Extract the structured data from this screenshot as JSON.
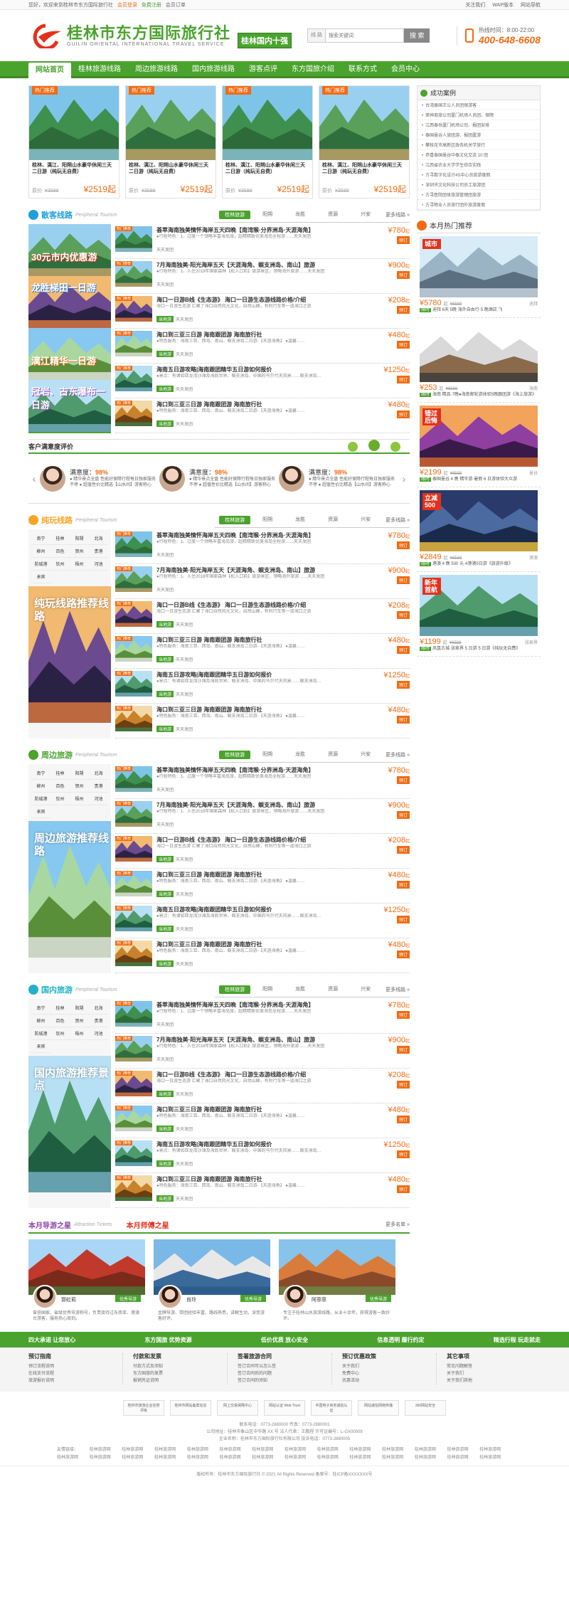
{
  "topbar": {
    "welcome": "您好，欢迎来到桂林市东方国际旅行社",
    "login": "会员登录",
    "register": "免费注册",
    "orders": "会员订单",
    "right": [
      "关注我们",
      "WAP版本",
      "网站导航"
    ]
  },
  "header": {
    "logo_name": "桂林市东方国际旅行社",
    "logo_en": "GUILIN ORIENTAL INTERNATIONAL TRAVEL SERVICE",
    "badge": "桂林国内十强",
    "search_select": "线 路",
    "search_placeholder": "搜索关键词",
    "search_button": "搜 索",
    "hotline_time": "热线时间：8:00-22:00",
    "hotline_number": "400-648-6608"
  },
  "nav": [
    "网站首页",
    "桂林旅游线路",
    "周边旅游线路",
    "国内旅游线路",
    "游客点评",
    "东方国旅介绍",
    "联系方式",
    "会员中心"
  ],
  "hot_cards": [
    {
      "tag": "热门推荐",
      "title": "桂林、漓江、阳朔山水豪华休闲三天二日游（纯玩无自费）",
      "label": "原价",
      "old": "¥3599",
      "price": "¥2519起"
    },
    {
      "tag": "热门推荐",
      "title": "桂林、漓江、阳朔山水豪华休闲三天二日游（纯玩无自费）",
      "label": "原价",
      "old": "¥3599",
      "price": "¥2519起"
    },
    {
      "tag": "热门推荐",
      "title": "桂林、漓江、阳朔山水豪华休闲三天二日游（纯玩无自费）",
      "label": "原价",
      "old": "¥3599",
      "price": "¥2519起"
    },
    {
      "tag": "热门推荐",
      "title": "桂林、漓江、阳朔山水豪华休闲三天二日游（纯玩无自费）",
      "label": "原价",
      "old": "¥3599",
      "price": "¥2519起"
    }
  ],
  "section_tabs": [
    "桂林旅游",
    "阳朔",
    "龙胜",
    "资源",
    "兴安"
  ],
  "more": "更多线路 »",
  "sections": [
    {
      "title": "散客线路",
      "en": "Peripheral Tourism",
      "color": "#1e9fd8"
    },
    {
      "title": "纯玩线路",
      "en": "Peripheral Tourism",
      "color": "#f5a623"
    },
    {
      "title": "周边旅游",
      "en": "Peripheral Tourism",
      "color": "#4aa32d"
    },
    {
      "title": "国内旅游",
      "en": "Peripheral Tourism",
      "color": "#21b0c8"
    }
  ],
  "routes": [
    {
      "name": "荟萃海南独美情怀海岸五天四晚【南湾猴·分界洲岛·天涯海角】",
      "desc": "●行程特色：1、过度一个领略丰富海岛旅，超精精致优美海岛全程游……天天发团",
      "tag": "",
      "tag2": "天天发团",
      "price": "¥780",
      "unit": "起"
    },
    {
      "name": "7月海南独美·阳光海岸五天【天涯海角、蜈支洲岛、南山】旅游",
      "desc": "●行程特色：1、入住2018年国家森林【松入口前】旅游景区，领略海外旅游……天天发团",
      "tag": "",
      "tag2": "天天发团",
      "price": "¥900",
      "unit": "起"
    },
    {
      "name": "海口一日游B线《生态游》 海口一日游生态游线路价格/介绍",
      "desc": "海口一日游生态游 汇聚了海口自然风光文化，自然山峰，有利行车等一道海口之旅",
      "tag": "当地游",
      "tag2": "天天发团",
      "price": "¥208",
      "unit": "起"
    },
    {
      "name": "海口到三亚三日游 海南跟团游 海南旅行社",
      "desc": "●特色服务：海南三亚、西岛、南山、蜈支洲岛二日游-【天涯海角】 ●温馨……",
      "tag": "当地游",
      "tag2": "天天发团",
      "price": "¥480",
      "unit": "起"
    },
    {
      "name": "海南五日游攻略|海南跟团精华五日游如何报价",
      "desc": "●景点：有诸如亚龙湾沙滩及海底世界、蜈支洲岛、中国的马尔代夫风景……蜈支洲岛…",
      "tag": "当地游",
      "tag2": "天天发团",
      "price": "¥1250",
      "unit": "起"
    },
    {
      "name": "海口到三亚三日游 海南跟团游 海南旅行社",
      "desc": "●特色服务：海南三亚、西岛、南山、蜈支洲岛二日游-【天涯海角】 ●温馨……",
      "tag": "当地游",
      "tag2": "天天发团",
      "price": "¥480",
      "unit": "起"
    }
  ],
  "book_label": "预订",
  "cities": [
    "南宁",
    "桂林",
    "阳朔",
    "北海",
    "柳州",
    "百色",
    "贺州",
    "贵港",
    "防城港",
    "钦州",
    "梧州",
    "河池",
    "来宾"
  ],
  "side_labels": {
    "s1": [
      "30元市内优惠游",
      "龙胜梯田一日游",
      "漓江精华一日游",
      "冠岩、古东瀑布一日游"
    ],
    "s2": "纯玩线路推荐线路",
    "s3": "周边旅游推荐线路",
    "s4": "国内旅游推荐景点"
  },
  "satisfaction": {
    "title": "客户满意度评价",
    "items": [
      {
        "label": "满意度：",
        "value": "98%",
        "text": "● 精华景点全盘 性能好保障行程每日独家服务不停 ● 超值性价比精选【山水间】游客称心"
      },
      {
        "label": "满意度：",
        "value": "98%",
        "text": "● 精华景点全盘 性能好保障行程每日独家服务不停 ● 超值性价比精选【山水间】游客称心"
      },
      {
        "label": "满意度：",
        "value": "98%",
        "text": "● 精华景点全盘 性能好保障行程每日独家服务不停 ● 超值性价比精选【山水间】游客称心"
      }
    ]
  },
  "success_cases": {
    "title": "成功案例",
    "items": [
      "台湾泰国王公人员团保游客",
      "荣神商旅公司厦门机场人员团、保障",
      "江西泰岳厦门机场公司、报团安排",
      "泰国曼谷人旅团游、报团厦游",
      "攀枝花市高新区政务机关学旅行",
      "恭喜泰国曼谷中泰文化交流 10 团",
      "江西省农业大学学生综合实践",
      "方寻数字化设计4S中心员旅游度假",
      "深圳市文化科技公司员工旅游团",
      "方寻医院团体旅游管理团旅游",
      "方寻物业人员旅行团外旅游度假"
    ]
  },
  "month_hot": {
    "title": "本月热门推荐",
    "items": [
      {
        "price": "¥5780",
        "unit": "起",
        "old": "¥6588",
        "dest": "迪拜",
        "badge": "限时",
        "desc": "迪拜 6天 5晚 海外自由行·5 晚酒店 飞"
      },
      {
        "price": "¥253",
        "unit": "起",
        "old": "¥6588",
        "dest": "海南",
        "badge": "限时",
        "desc": "海南 精品·7晚●海南邮轮游体验5晚跟团游《海上旅游》"
      },
      {
        "price": "¥2199",
        "unit": "起",
        "old": "¥6588",
        "dest": "曼谷",
        "badge": "限时",
        "desc": "泰国曼谷 4 晚 精华游·暑假 6 日游体验大众游"
      },
      {
        "price": "¥2849",
        "unit": "起",
        "old": "¥6588",
        "dest": "港澳",
        "badge": "限时",
        "desc": "港澳 4 晚 500 元·4港澳5日游《旅游升级》"
      },
      {
        "price": "¥1199",
        "unit": "起",
        "old": "¥6588",
        "dest": "张家界",
        "badge": "限时",
        "desc": "凤凰古城·张家界 5 日游 5 日游《纯玩无自费》"
      }
    ],
    "overlays": [
      "城市",
      "",
      "错过后悔",
      "立减500",
      "新年首航"
    ]
  },
  "guides": {
    "t1": "本月导游之星",
    "en1": "Attraction Tickets",
    "t2": "本月师傅之星",
    "more": "更多名单 »",
    "label": "优秀导游",
    "items": [
      {
        "name": "郭虹莉",
        "text": "曾获国家、省级优秀导游称号，负责接待过东南亚、港澳台游客，服务热心周到。"
      },
      {
        "name": "肖玲",
        "text": "金牌导游、带团经验丰富，路线熟悉，讲解生动，深受游客好评。"
      },
      {
        "name": "阿菲菲",
        "text": "专注于桂林山水旅游线路，从业十余年，获得游客一致好评。"
      }
    ]
  },
  "promo": [
    "四大承诺 让您放心",
    "东方国旅 优势资源",
    "低价优质 放心安全",
    "信息透明 履行约定",
    "精选行程 玩走就走"
  ],
  "help": [
    {
      "h": "预订指南",
      "items": [
        "预订流程说明",
        "在线支付流程",
        "旅游报价说明"
      ]
    },
    {
      "h": "付款和发票",
      "items": [
        "付款方式及须知",
        "东方国旅的发票",
        "报销凭证说明"
      ]
    },
    {
      "h": "签署旅游合同",
      "items": [
        "签订合同可以怎么签",
        "签订合同后的问题",
        "签订合同的须知"
      ]
    },
    {
      "h": "预订优惠政策",
      "items": [
        "关于我们",
        "免费中心",
        "优惠活动"
      ]
    },
    {
      "h": "其它事项",
      "items": [
        "常见问题解答",
        "关于我们",
        "关于我们其他"
      ]
    }
  ],
  "certs": [
    "桂林市旅游企业信誉评级",
    "桂林市网站备案信息",
    "网上交易保障中心",
    "网站认证 Web Trust",
    "中国电子商务诚信认证",
    "网站诚信网络传播",
    "360网站安全"
  ],
  "footer_info": [
    "联系电话：0773-2880000  传真：0773-2880001",
    "公司地址：桂林市象山区中华路 XX 号  法人代表：王鹏程  许可证编号：L-GX00009",
    "企业名称：桂林市东方国际旅行社有限公司  投诉电话：0773-2880005"
  ],
  "footer_links": [
    "友情链接：",
    "桂林旅游网",
    "桂林旅游网",
    "桂林旅游网",
    "桂林旅游网",
    "桂林旅游网",
    "桂林旅游网",
    "桂林旅游网",
    "桂林旅游网",
    "桂林旅游网",
    "桂林旅游网",
    "桂林旅游网",
    "桂林旅游网",
    "桂林旅游网",
    "桂林旅游网",
    "桂林旅游网",
    "桂林旅游网",
    "桂林旅游网",
    "桂林旅游网",
    "桂林旅游网",
    "桂林旅游网",
    "桂林旅游网",
    "桂林旅游网",
    "桂林旅游网",
    "桂林旅游网",
    "桂林旅游网",
    "桂林旅游网",
    "桂林旅游网"
  ],
  "copyright": "版权所有：桂林市东方国际旅行社 © 2021 All Rights Reserved  备案号：桂ICP备XXXXXXX号"
}
